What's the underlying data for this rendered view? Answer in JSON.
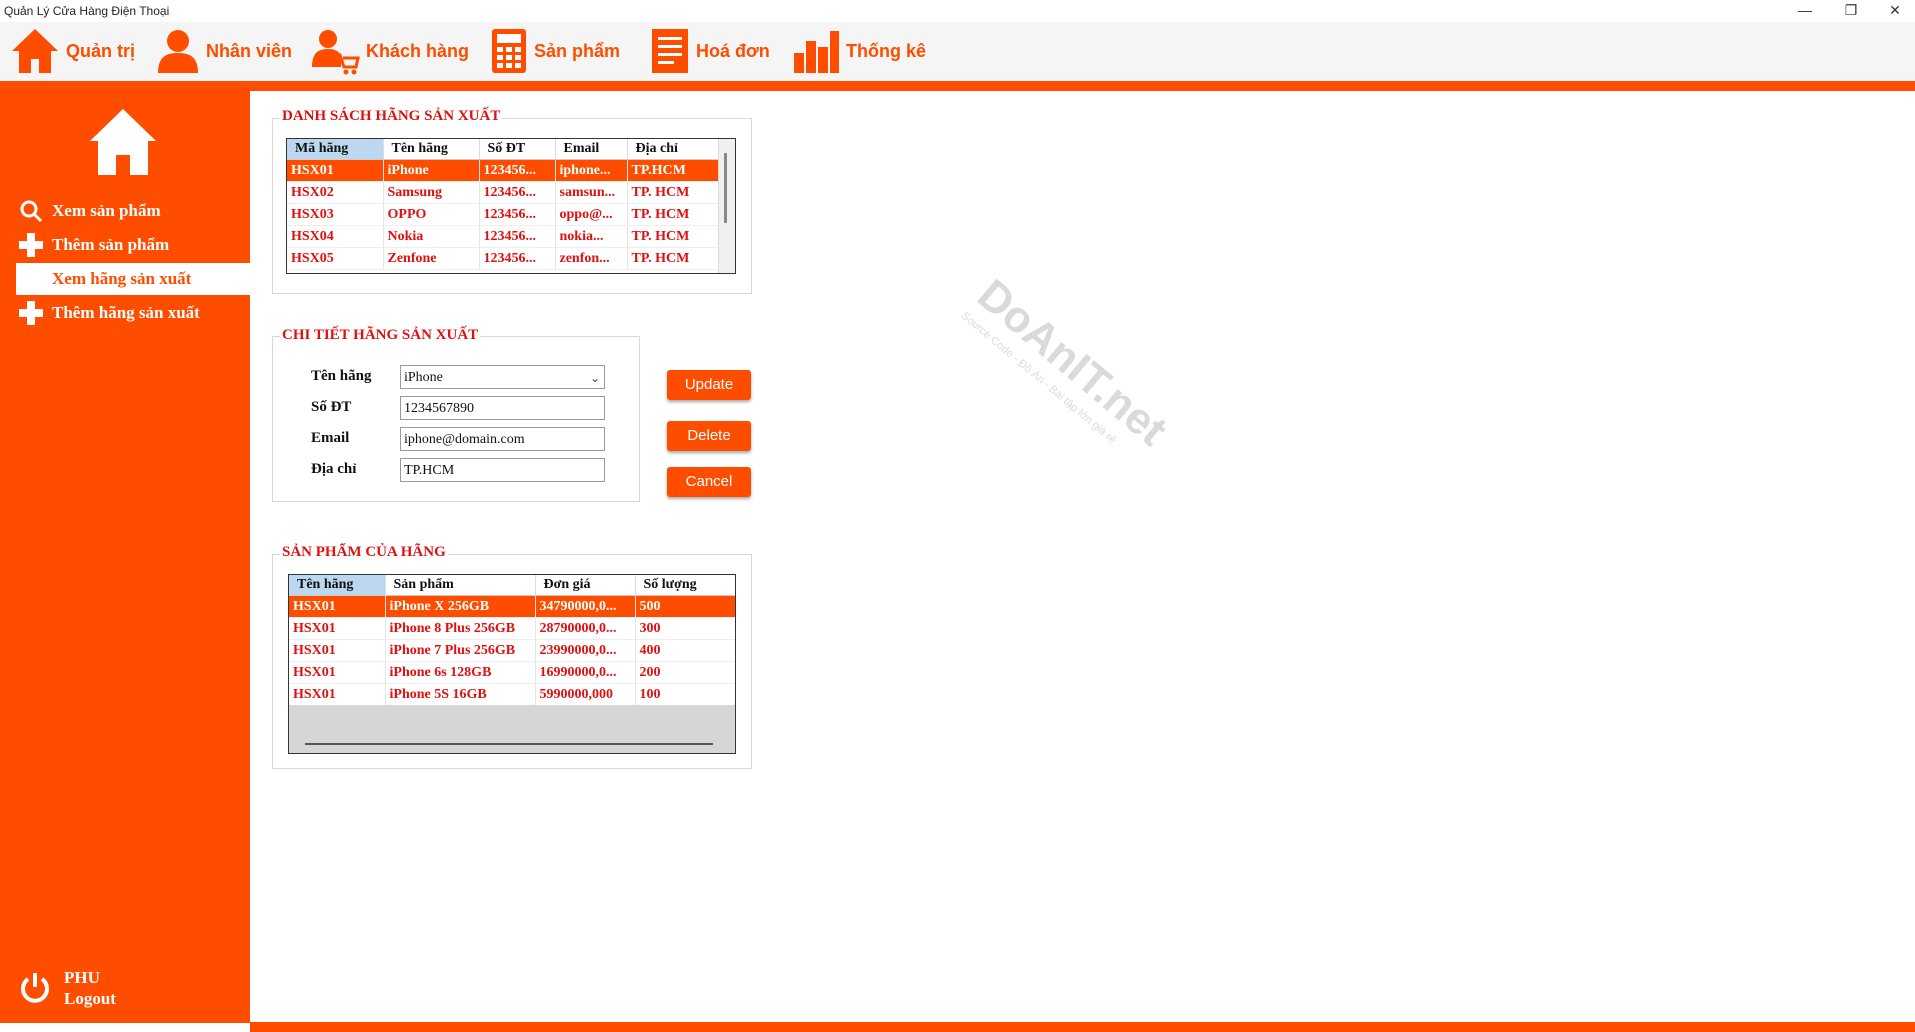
{
  "window": {
    "title": "Quản Lý Cửa Hàng Điện Thoại",
    "minimize_glyph": "—",
    "restore_glyph": "❐",
    "close_glyph": "✕"
  },
  "nav": [
    {
      "label": "Quản trị",
      "icon": "home-icon"
    },
    {
      "label": "Nhân viên",
      "icon": "user-icon"
    },
    {
      "label": "Khách hàng",
      "icon": "customer-cart-icon"
    },
    {
      "label": "Sản phẩm",
      "icon": "calculator-icon"
    },
    {
      "label": "Hoá đơn",
      "icon": "invoice-icon"
    },
    {
      "label": "Thống kê",
      "icon": "bar-chart-icon"
    }
  ],
  "sidebar": {
    "items": [
      {
        "label": "Xem sản phẩm",
        "icon": "search-icon"
      },
      {
        "label": "Thêm sản phẩm",
        "icon": "plus-icon"
      },
      {
        "label": "Xem hãng sản xuất",
        "icon": "none",
        "active": true
      },
      {
        "label": "Thêm hãng sản xuất",
        "icon": "plus-icon"
      }
    ],
    "user": "PHU",
    "logout_label": "Logout"
  },
  "manufacturers": {
    "title": "DANH SÁCH HÃNG SẢN XUẤT",
    "columns": [
      "Mã hãng",
      "Tên hãng",
      "Số ĐT",
      "Email",
      "Địa chỉ"
    ],
    "rows": [
      [
        "HSX01",
        "iPhone",
        "123456...",
        "iphone...",
        "TP.HCM"
      ],
      [
        "HSX02",
        "Samsung",
        "123456...",
        "samsun...",
        "TP. HCM"
      ],
      [
        "HSX03",
        "OPPO",
        "123456...",
        "oppo@...",
        "TP. HCM"
      ],
      [
        "HSX04",
        "Nokia",
        "123456...",
        "nokia...",
        "TP. HCM"
      ],
      [
        "HSX05",
        "Zenfone",
        "123456...",
        "zenfon...",
        "TP. HCM"
      ]
    ]
  },
  "detail": {
    "title": "CHI TIẾT HÃNG SẢN XUẤT",
    "name_label": "Tên hãng",
    "name_value": "iPhone",
    "phone_label": "Số ĐT",
    "phone_value": "1234567890",
    "email_label": "Email",
    "email_value": "iphone@domain.com",
    "address_label": "Địa chỉ",
    "address_value": "TP.HCM",
    "update_label": "Update",
    "delete_label": "Delete",
    "cancel_label": "Cancel"
  },
  "products": {
    "title": "SẢN PHẨM CỦA HÃNG",
    "columns": [
      "Tên hãng",
      "Sản phẩm",
      "Đơn giá",
      "Số lượng"
    ],
    "rows": [
      [
        "HSX01",
        "iPhone X 256GB",
        "34790000,0...",
        "500"
      ],
      [
        "HSX01",
        "iPhone 8 Plus 256GB",
        "28790000,0...",
        "300"
      ],
      [
        "HSX01",
        "iPhone 7 Plus 256GB",
        "23990000,0...",
        "400"
      ],
      [
        "HSX01",
        "iPhone 6s 128GB",
        "16990000,0...",
        "200"
      ],
      [
        "HSX01",
        "iPhone 5S 16GB",
        "5990000,000",
        "100"
      ]
    ]
  },
  "watermark": {
    "brand": "DoAnIT.net",
    "tagline": "Source Code - Đồ Án - Bài tập lớn giá rẻ"
  },
  "colors": {
    "accent": "#ff4d00",
    "text_red": "#e01010",
    "selection": "#ff4d00"
  }
}
